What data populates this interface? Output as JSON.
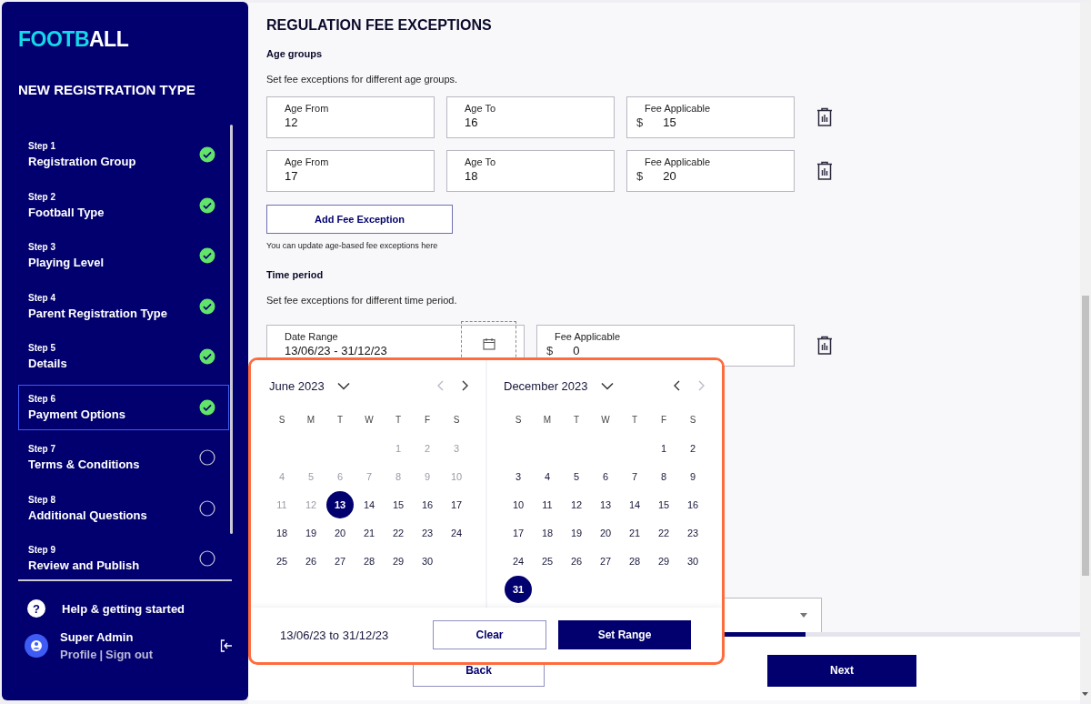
{
  "sidebar": {
    "logo": [
      {
        "text": "FOOTB",
        "accent": true
      },
      {
        "text": "ALL",
        "accent": false
      }
    ],
    "heading": "NEW REGISTRATION TYPE",
    "steps": [
      {
        "step": "Step 1",
        "title": "Registration Group",
        "completed": true,
        "selected": false
      },
      {
        "step": "Step 2",
        "title": "Football Type",
        "completed": true,
        "selected": false
      },
      {
        "step": "Step 3",
        "title": "Playing Level",
        "completed": true,
        "selected": false
      },
      {
        "step": "Step 4",
        "title": "Parent Registration Type",
        "completed": true,
        "selected": false
      },
      {
        "step": "Step 5",
        "title": "Details",
        "completed": true,
        "selected": false
      },
      {
        "step": "Step 6",
        "title": "Payment Options",
        "completed": true,
        "selected": true
      },
      {
        "step": "Step 7",
        "title": "Terms & Conditions",
        "completed": false,
        "selected": false
      },
      {
        "step": "Step 8",
        "title": "Additional Questions",
        "completed": false,
        "selected": false
      },
      {
        "step": "Step 9",
        "title": "Review and Publish",
        "completed": false,
        "selected": false
      }
    ],
    "help": {
      "icon": "?",
      "label": "Help & getting started"
    },
    "user": {
      "name": "Super Admin",
      "links": [
        "Profile",
        "Sign out"
      ],
      "separator": "|"
    }
  },
  "section": {
    "title": "REGULATION FEE EXCEPTIONS",
    "age_groups": {
      "heading": "Age groups",
      "description": "Set fee exceptions for different age groups.",
      "rows": [
        {
          "age_from": {
            "label": "Age From",
            "value": "12"
          },
          "age_to": {
            "label": "Age To",
            "value": "16"
          },
          "fee": {
            "label": "Fee Applicable",
            "currency": "$",
            "value": "15"
          }
        },
        {
          "age_from": {
            "label": "Age From",
            "value": "17"
          },
          "age_to": {
            "label": "Age To",
            "value": "18"
          },
          "fee": {
            "label": "Fee Applicable",
            "currency": "$",
            "value": "20"
          }
        }
      ],
      "add_button": "Add Fee Exception",
      "hint": "You can update age-based fee exceptions here"
    },
    "time_period": {
      "heading": "Time period",
      "description": "Set fee exceptions for different time period.",
      "rows": [
        {
          "date_range": {
            "label": "Date Range",
            "value": "13/06/23 - 31/12/23"
          },
          "fee": {
            "label": "Fee Applicable",
            "currency": "$",
            "value": "0"
          }
        }
      ]
    }
  },
  "date_picker": {
    "months": [
      {
        "title": "June 2023",
        "nav": [
          {
            "kind": "prev",
            "disabled": true
          },
          {
            "kind": "next",
            "disabled": false
          }
        ],
        "weekdays": [
          "S",
          "M",
          "T",
          "W",
          "T",
          "F",
          "S"
        ],
        "weeks": [
          {
            "kind": "end",
            "days": [
              {
                "label": "1",
                "disabled": true,
                "selected": false
              },
              {
                "label": "2",
                "disabled": true,
                "selected": false
              },
              {
                "label": "3",
                "disabled": true,
                "selected": false
              }
            ]
          },
          {
            "kind": "start",
            "days": [
              {
                "label": "4",
                "disabled": true,
                "selected": false
              },
              {
                "label": "5",
                "disabled": true,
                "selected": false
              },
              {
                "label": "6",
                "disabled": true,
                "selected": false
              },
              {
                "label": "7",
                "disabled": true,
                "selected": false
              },
              {
                "label": "8",
                "disabled": true,
                "selected": false
              },
              {
                "label": "9",
                "disabled": true,
                "selected": false
              },
              {
                "label": "10",
                "disabled": true,
                "selected": false
              }
            ]
          },
          {
            "kind": "start",
            "days": [
              {
                "label": "11",
                "disabled": true,
                "selected": false
              },
              {
                "label": "12",
                "disabled": true,
                "selected": false
              },
              {
                "label": "13",
                "disabled": false,
                "selected": true
              },
              {
                "label": "14",
                "disabled": false,
                "selected": false
              },
              {
                "label": "15",
                "disabled": false,
                "selected": false
              },
              {
                "label": "16",
                "disabled": false,
                "selected": false
              },
              {
                "label": "17",
                "disabled": false,
                "selected": false
              }
            ]
          },
          {
            "kind": "start",
            "days": [
              {
                "label": "18",
                "disabled": false,
                "selected": false
              },
              {
                "label": "19",
                "disabled": false,
                "selected": false
              },
              {
                "label": "20",
                "disabled": false,
                "selected": false
              },
              {
                "label": "21",
                "disabled": false,
                "selected": false
              },
              {
                "label": "22",
                "disabled": false,
                "selected": false
              },
              {
                "label": "23",
                "disabled": false,
                "selected": false
              },
              {
                "label": "24",
                "disabled": false,
                "selected": false
              }
            ]
          },
          {
            "kind": "start",
            "days": [
              {
                "label": "25",
                "disabled": false,
                "selected": false
              },
              {
                "label": "26",
                "disabled": false,
                "selected": false
              },
              {
                "label": "27",
                "disabled": false,
                "selected": false
              },
              {
                "label": "28",
                "disabled": false,
                "selected": false
              },
              {
                "label": "29",
                "disabled": false,
                "selected": false
              },
              {
                "label": "30",
                "disabled": false,
                "selected": false
              }
            ]
          }
        ]
      },
      {
        "title": "December 2023",
        "nav": [
          {
            "kind": "prev",
            "disabled": false
          },
          {
            "kind": "next",
            "disabled": true
          }
        ],
        "weekdays": [
          "S",
          "M",
          "T",
          "W",
          "T",
          "F",
          "S"
        ],
        "weeks": [
          {
            "kind": "end",
            "days": [
              {
                "label": "1",
                "disabled": false,
                "selected": false
              },
              {
                "label": "2",
                "disabled": false,
                "selected": false
              }
            ]
          },
          {
            "kind": "start",
            "days": [
              {
                "label": "3",
                "disabled": false,
                "selected": false
              },
              {
                "label": "4",
                "disabled": false,
                "selected": false
              },
              {
                "label": "5",
                "disabled": false,
                "selected": false
              },
              {
                "label": "6",
                "disabled": false,
                "selected": false
              },
              {
                "label": "7",
                "disabled": false,
                "selected": false
              },
              {
                "label": "8",
                "disabled": false,
                "selected": false
              },
              {
                "label": "9",
                "disabled": false,
                "selected": false
              }
            ]
          },
          {
            "kind": "start",
            "days": [
              {
                "label": "10",
                "disabled": false,
                "selected": false
              },
              {
                "label": "11",
                "disabled": false,
                "selected": false
              },
              {
                "label": "12",
                "disabled": false,
                "selected": false
              },
              {
                "label": "13",
                "disabled": false,
                "selected": false
              },
              {
                "label": "14",
                "disabled": false,
                "selected": false
              },
              {
                "label": "15",
                "disabled": false,
                "selected": false
              },
              {
                "label": "16",
                "disabled": false,
                "selected": false
              }
            ]
          },
          {
            "kind": "start",
            "days": [
              {
                "label": "17",
                "disabled": false,
                "selected": false
              },
              {
                "label": "18",
                "disabled": false,
                "selected": false
              },
              {
                "label": "19",
                "disabled": false,
                "selected": false
              },
              {
                "label": "20",
                "disabled": false,
                "selected": false
              },
              {
                "label": "21",
                "disabled": false,
                "selected": false
              },
              {
                "label": "22",
                "disabled": false,
                "selected": false
              },
              {
                "label": "23",
                "disabled": false,
                "selected": false
              }
            ]
          },
          {
            "kind": "start",
            "days": [
              {
                "label": "24",
                "disabled": false,
                "selected": false
              },
              {
                "label": "25",
                "disabled": false,
                "selected": false
              },
              {
                "label": "26",
                "disabled": false,
                "selected": false
              },
              {
                "label": "27",
                "disabled": false,
                "selected": false
              },
              {
                "label": "28",
                "disabled": false,
                "selected": false
              },
              {
                "label": "29",
                "disabled": false,
                "selected": false
              },
              {
                "label": "30",
                "disabled": false,
                "selected": false
              }
            ]
          },
          {
            "kind": "start",
            "days": [
              {
                "label": "31",
                "disabled": false,
                "selected": true
              }
            ]
          }
        ]
      }
    ],
    "range_text": "13/06/23 to 31/12/23",
    "buttons": [
      {
        "label": "Clear",
        "kind": "secondary"
      },
      {
        "label": "Set Range",
        "kind": "primary"
      }
    ]
  },
  "progress": {
    "level": 0.67
  },
  "footer": {
    "buttons": [
      {
        "label": "Back",
        "kind": "secondary"
      },
      {
        "label": "Next",
        "kind": "primary"
      }
    ]
  }
}
